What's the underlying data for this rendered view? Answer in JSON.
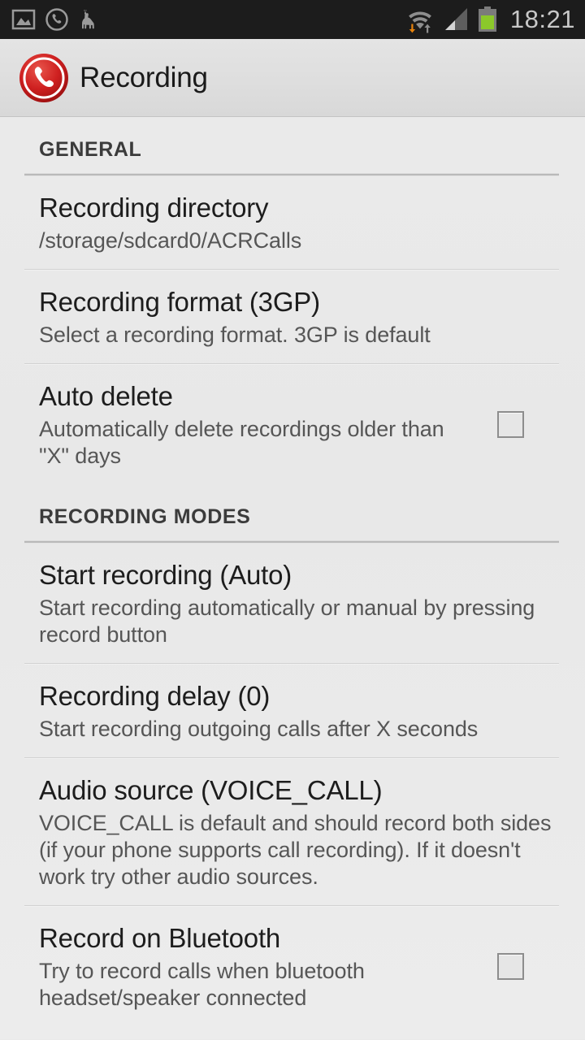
{
  "status_bar": {
    "notification_icons": [
      "image-icon",
      "phone-circle-icon",
      "llama-icon"
    ],
    "system_icons": [
      "wifi-icon",
      "cellular-signal-icon",
      "battery-icon"
    ],
    "clock": "18:21",
    "background_color": "#1c1c1c",
    "text_color": "#c8c8c8",
    "battery_color": "#8bc82a",
    "data_arrow_color": "#e8830c"
  },
  "action_bar": {
    "icon": "call-recorder-icon",
    "title": "Recording",
    "icon_color": "#c21b1b"
  },
  "sections": [
    {
      "header": "GENERAL",
      "items": [
        {
          "title": "Recording directory",
          "summary": "/storage/sdcard0/ACRCalls",
          "widget": "none"
        },
        {
          "title": "Recording format (3GP)",
          "summary": "Select a recording format. 3GP is default",
          "widget": "none"
        },
        {
          "title": "Auto delete",
          "summary": "Automatically delete recordings older than \"X\" days",
          "widget": "checkbox",
          "checked": false
        }
      ]
    },
    {
      "header": "RECORDING MODES",
      "items": [
        {
          "title": "Start recording (Auto)",
          "summary": "Start recording automatically or manual by pressing record button",
          "widget": "none"
        },
        {
          "title": "Recording delay (0)",
          "summary": "Start recording outgoing calls after X seconds",
          "widget": "none"
        },
        {
          "title": "Audio source (VOICE_CALL)",
          "summary": "VOICE_CALL is default and should record both sides (if your phone supports call recording). If it doesn't work try other audio sources.",
          "widget": "none"
        },
        {
          "title": "Record on Bluetooth",
          "summary": "Try to record calls when bluetooth headset/speaker connected",
          "widget": "checkbox",
          "checked": false
        }
      ]
    }
  ]
}
